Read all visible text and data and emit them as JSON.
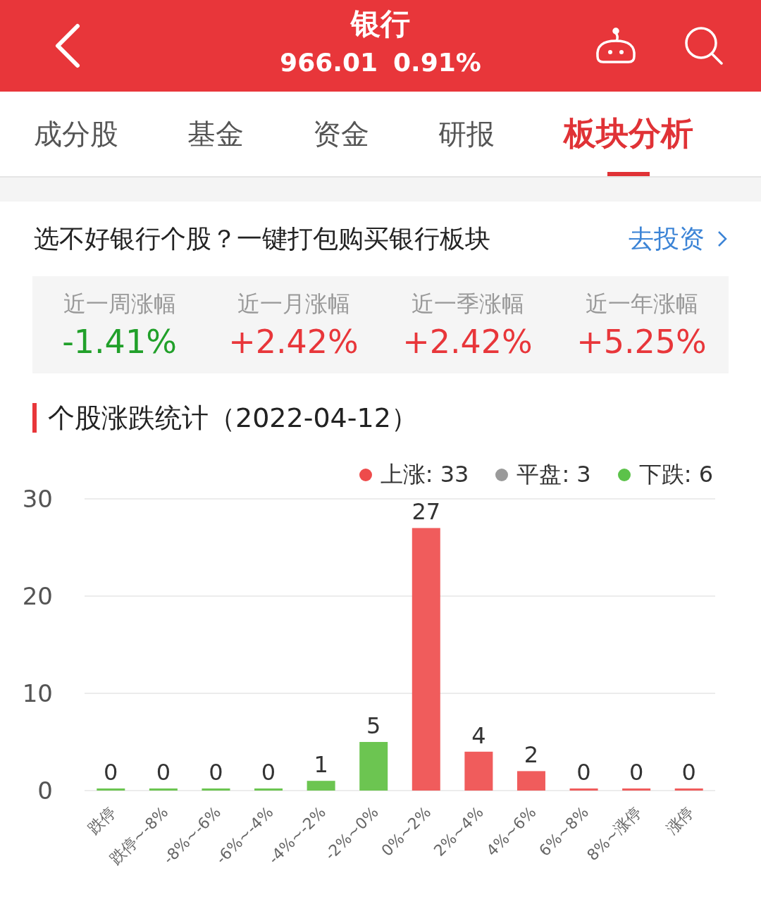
{
  "header": {
    "title": "银行",
    "price": "966.01",
    "change": "0.91%"
  },
  "tabs": [
    {
      "label": "成分股",
      "selected": false
    },
    {
      "label": "基金",
      "selected": false
    },
    {
      "label": "资金",
      "selected": false
    },
    {
      "label": "研报",
      "selected": false
    },
    {
      "label": "板块分析",
      "selected": true
    }
  ],
  "promo": {
    "text": "选不好银行个股？一键打包购买银行板块",
    "link": "去投资"
  },
  "stats": [
    {
      "label": "近一周涨幅",
      "value": "-1.41%",
      "color": "#21a02a"
    },
    {
      "label": "近一月涨幅",
      "value": "+2.42%",
      "color": "#e8363a"
    },
    {
      "label": "近一季涨幅",
      "value": "+2.42%",
      "color": "#e8363a"
    },
    {
      "label": "近一年涨幅",
      "value": "+5.25%",
      "color": "#e8363a"
    }
  ],
  "distribution": {
    "title": "个股涨跌统计（2022-04-12）",
    "legend": [
      {
        "label": "上涨: 33",
        "color": "#ee4b4b"
      },
      {
        "label": "平盘: 3",
        "color": "#9a9a9a"
      },
      {
        "label": "下跌: 6",
        "color": "#5cc24a"
      }
    ],
    "chart_data": {
      "type": "bar",
      "categories": [
        "跌停",
        "跌停~-8%",
        "-8%~-6%",
        "-6%~-4%",
        "-4%~-2%",
        "-2%~0%",
        "0%~2%",
        "2%~4%",
        "4%~6%",
        "6%~8%",
        "8%~涨停",
        "涨停"
      ],
      "series": [
        {
          "color": "#6cc551",
          "values": [
            0,
            0,
            0,
            0,
            1,
            5,
            null,
            null,
            null,
            null,
            null,
            null
          ]
        },
        {
          "color": "#f05c5c",
          "values": [
            null,
            null,
            null,
            null,
            null,
            null,
            27,
            4,
            2,
            0,
            0,
            0
          ]
        }
      ],
      "ylim": [
        0,
        30
      ],
      "yticks": [
        0,
        10,
        20,
        30
      ],
      "data_labels": true
    }
  }
}
